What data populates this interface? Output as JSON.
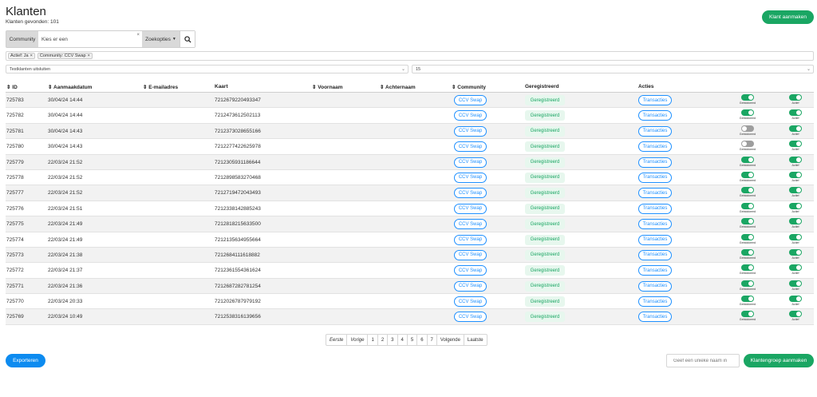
{
  "header": {
    "title": "Klanten",
    "subtitle": "Klanten gevonden: 101",
    "create_button": "Klant aanmaken"
  },
  "search": {
    "label": "Community",
    "input_value": "Kies er een",
    "clear_symbol": "×",
    "options_label": "Zoekopties",
    "search_icon": "search-icon"
  },
  "filters": {
    "chips": [
      "Actief: Ja",
      "Community: CCV Swap"
    ],
    "remove_symbol": "×"
  },
  "selects": {
    "left_value": "Testklanten uitsluiten",
    "right_value": "15"
  },
  "table": {
    "headers": {
      "id": "ID",
      "created": "Aanmaakdatum",
      "email": "E-mailadres",
      "card": "Kaart",
      "firstname": "Voornaam",
      "lastname": "Achternaam",
      "community": "Community",
      "registered": "Geregistreerd",
      "actions": "Acties"
    },
    "sort_symbol": "⇕",
    "rows": [
      {
        "id": "725783",
        "date": "30/04/24 14:44",
        "card": "7212679220493347",
        "community": "CCV Swap",
        "registered": "Geregistreerd",
        "action": "Transacties",
        "blocked_label": "Geblokkeerd",
        "active_label": "Actief"
      },
      {
        "id": "725782",
        "date": "30/04/24 14:44",
        "card": "7212473612502113",
        "community": "CCV Swap",
        "registered": "Geregistreerd",
        "action": "Transacties",
        "blocked_label": "Geblokkeerd",
        "active_label": "Actief"
      },
      {
        "id": "725781",
        "date": "30/04/24 14:43",
        "card": "7212373028655166",
        "community": "CCV Swap",
        "registered": "Geregistreerd",
        "action": "Transacties",
        "blocked_label": "Geblokkeerd",
        "active_label": "Actief"
      },
      {
        "id": "725780",
        "date": "30/04/24 14:43",
        "card": "7212277422625978",
        "community": "CCV Swap",
        "registered": "Geregistreerd",
        "action": "Transacties",
        "blocked_label": "Geblokkeerd",
        "active_label": "Actief"
      },
      {
        "id": "725779",
        "date": "22/03/24 21:52",
        "card": "7212305931186644",
        "community": "CCV Swap",
        "registered": "Geregistreerd",
        "action": "Transacties",
        "blocked_label": "Geblokkeerd",
        "active_label": "Actief"
      },
      {
        "id": "725778",
        "date": "22/03/24 21:52",
        "card": "7212898583270468",
        "community": "CCV Swap",
        "registered": "Geregistreerd",
        "action": "Transacties",
        "blocked_label": "Geblokkeerd",
        "active_label": "Actief"
      },
      {
        "id": "725777",
        "date": "22/03/24 21:52",
        "card": "7212719472043493",
        "community": "CCV Swap",
        "registered": "Geregistreerd",
        "action": "Transacties",
        "blocked_label": "Geblokkeerd",
        "active_label": "Actief"
      },
      {
        "id": "725776",
        "date": "22/03/24 21:51",
        "card": "7212338142885243",
        "community": "CCV Swap",
        "registered": "Geregistreerd",
        "action": "Transacties",
        "blocked_label": "Geblokkeerd",
        "active_label": "Actief"
      },
      {
        "id": "725775",
        "date": "22/03/24 21:49",
        "card": "7212818215633500",
        "community": "CCV Swap",
        "registered": "Geregistreerd",
        "action": "Transacties",
        "blocked_label": "Geblokkeerd",
        "active_label": "Actief"
      },
      {
        "id": "725774",
        "date": "22/03/24 21:49",
        "card": "7212135634955664",
        "community": "CCV Swap",
        "registered": "Geregistreerd",
        "action": "Transacties",
        "blocked_label": "Geblokkeerd",
        "active_label": "Actief"
      },
      {
        "id": "725773",
        "date": "22/03/24 21:38",
        "card": "7212684111618882",
        "community": "CCV Swap",
        "registered": "Geregistreerd",
        "action": "Transacties",
        "blocked_label": "Geblokkeerd",
        "active_label": "Actief"
      },
      {
        "id": "725772",
        "date": "22/03/24 21:37",
        "card": "7212361554361624",
        "community": "CCV Swap",
        "registered": "Geregistreerd",
        "action": "Transacties",
        "blocked_label": "Geblokkeerd",
        "active_label": "Actief"
      },
      {
        "id": "725771",
        "date": "22/03/24 21:36",
        "card": "7212687282781254",
        "community": "CCV Swap",
        "registered": "Geregistreerd",
        "action": "Transacties",
        "blocked_label": "Geblokkeerd",
        "active_label": "Actief"
      },
      {
        "id": "725770",
        "date": "22/03/24 20:33",
        "card": "7212026787979192",
        "community": "CCV Swap",
        "registered": "Geregistreerd",
        "action": "Transacties",
        "blocked_label": "Geblokkeerd",
        "active_label": "Actief"
      },
      {
        "id": "725769",
        "date": "22/03/24 10:49",
        "card": "7212538316139656",
        "community": "CCV Swap",
        "registered": "Geregistreerd",
        "action": "Transacties",
        "blocked_label": "Geblokkeerd",
        "active_label": "Actief"
      }
    ]
  },
  "pagination": {
    "first": "Eerste",
    "prev": "Vorige",
    "pages": [
      "1",
      "2",
      "3",
      "4",
      "5",
      "6",
      "7"
    ],
    "next": "Volgende",
    "last": "Laatste"
  },
  "footer": {
    "export_button": "Exporteren",
    "group_name_placeholder": "Geef een unieke naam in",
    "group_button": "Klantengroep aanmaken"
  },
  "colors": {
    "primary_green": "#1aa663",
    "primary_blue": "#0d8bf0",
    "toggle_off": "#9e9e9e"
  }
}
